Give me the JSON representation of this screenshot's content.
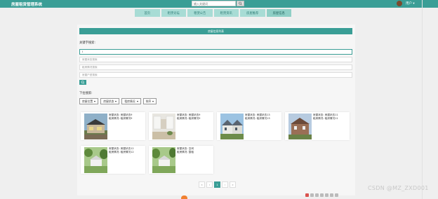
{
  "header": {
    "brand": "房屋租赁管理系统",
    "search_placeholder": "输入关键词",
    "user_label": "用户 ▾"
  },
  "nav": [
    {
      "label": "首页"
    },
    {
      "label": "租赁论坛"
    },
    {
      "label": "租赁公告"
    },
    {
      "label": "租赁资讯"
    },
    {
      "label": "房屋推荐"
    },
    {
      "label": "房屋信息"
    }
  ],
  "panel": {
    "title": "房屋信息列表",
    "keyword_label": "关键字搜索:",
    "inputs": [
      {
        "value": "I",
        "placeholder": ""
      },
      {
        "value": "",
        "placeholder": "房屋状态搜索"
      },
      {
        "value": "",
        "placeholder": "租房情况搜索"
      },
      {
        "value": "",
        "placeholder": "房屋户型搜索"
      }
    ],
    "dropdown_label": "下拉搜索:",
    "filters": [
      {
        "label": "房屋位置"
      },
      {
        "label": "房屋状态"
      },
      {
        "label": "租房情况"
      },
      {
        "label": "排序"
      }
    ]
  },
  "cards": [
    {
      "line1": "房屋状态: 房屋状态9",
      "line2": "租房情况: 租房情况9"
    },
    {
      "line1": "房屋状态: 房屋状态9",
      "line2": "租房情况: 租房情况9"
    },
    {
      "line1": "房屋状态: 房屋状态13",
      "line2": "租房情况: 租房情况13"
    },
    {
      "line1": "房屋状态: 房屋状态11",
      "line2": "租房情况: 租房情况11"
    },
    {
      "line1": "房屋状态: 房屋状态12",
      "line2": "租房情况: 租房情况12"
    },
    {
      "line1": "房屋状态: 空闲",
      "line2": "租房情况: 整租"
    }
  ],
  "pager": {
    "first": "«",
    "prev": "‹",
    "current": "1",
    "next": "›",
    "last": "»"
  },
  "watermark": "CSDN @MZ_ZXD001"
}
